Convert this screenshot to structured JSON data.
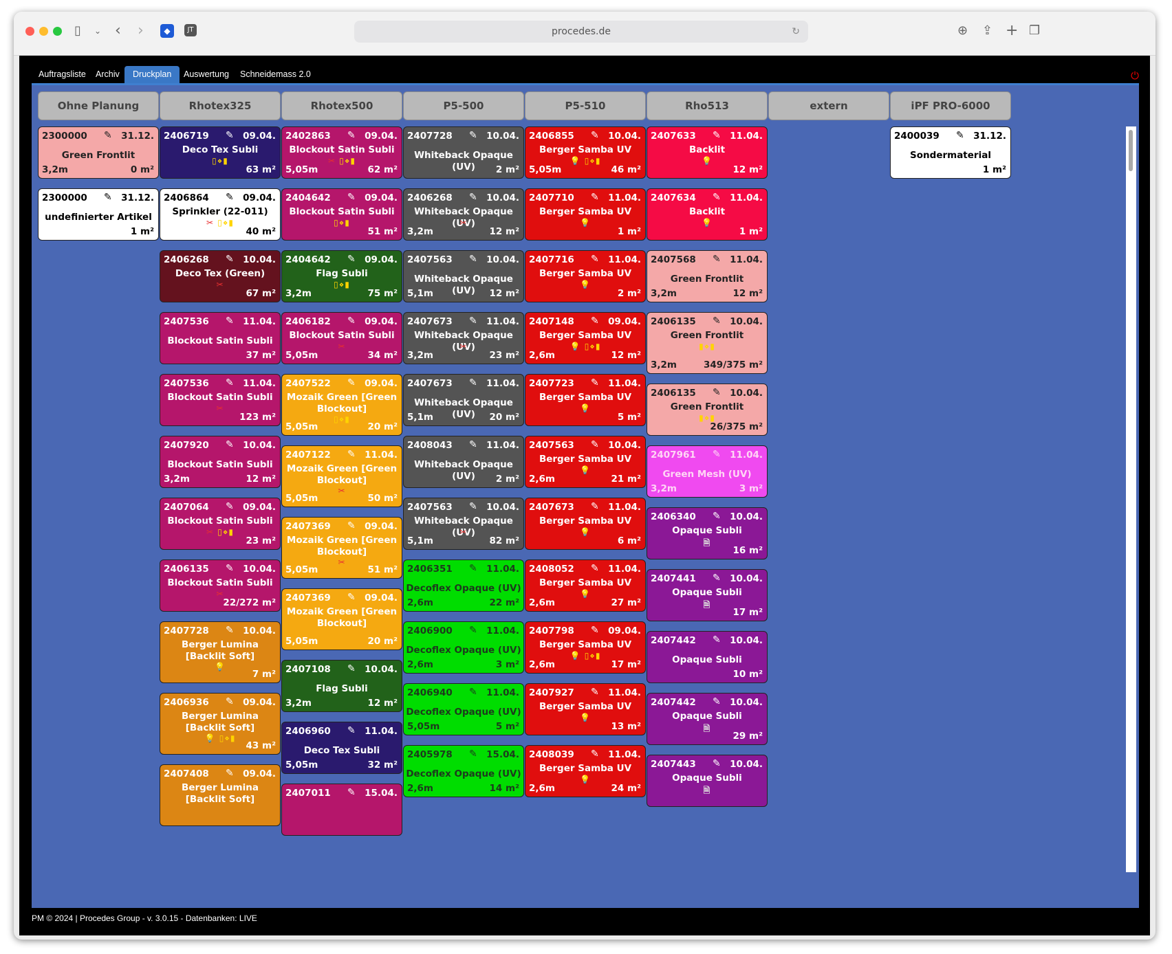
{
  "browser": {
    "url": "procedes.de"
  },
  "nav": {
    "tabs": [
      {
        "label": "Auftragsliste",
        "active": false
      },
      {
        "label": "Archiv",
        "active": false
      },
      {
        "label": "Druckplan",
        "active": true
      },
      {
        "label": "Auswertung",
        "active": false
      },
      {
        "label": "Schneidemass 2.0",
        "active": false
      }
    ]
  },
  "columns": [
    {
      "title": "Ohne Planung",
      "cards": [
        {
          "id": "2300000",
          "date": "31.12.",
          "name": "Green Frontlit",
          "icons": "",
          "length": "3,2m",
          "area": "0 m²",
          "color": "pink"
        },
        {
          "id": "2300000",
          "date": "31.12.",
          "name": "undefinierter Artikel",
          "icons": "",
          "length": "",
          "area": "1 m²",
          "color": "white"
        }
      ]
    },
    {
      "title": "Rhotex325",
      "cards": [
        {
          "id": "2406719",
          "date": "09.04.",
          "name": "Deco Tex Subli",
          "icons": "▯⋄▮",
          "length": "",
          "area": "63 m²",
          "color": "navy"
        },
        {
          "id": "2406864",
          "date": "09.04.",
          "name": "Sprinkler (22-011)",
          "icons": "✂ ▯⋄▮",
          "length": "",
          "area": "40 m²",
          "color": "white"
        },
        {
          "id": "2406268",
          "date": "10.04.",
          "name": "Deco Tex (Green)",
          "icons": "✂",
          "length": "",
          "area": "67 m²",
          "color": "maroon"
        },
        {
          "id": "2407536",
          "date": "11.04.",
          "name": "Blockout Satin Subli",
          "icons": "",
          "length": "",
          "area": "37 m²",
          "color": "mag"
        },
        {
          "id": "2407536",
          "date": "11.04.",
          "name": "Blockout Satin Subli",
          "icons": "✂",
          "length": "",
          "area": "123 m²",
          "color": "mag"
        },
        {
          "id": "2407920",
          "date": "10.04.",
          "name": "Blockout Satin Subli",
          "icons": "",
          "length": "3,2m",
          "area": "12 m²",
          "color": "mag"
        },
        {
          "id": "2407064",
          "date": "09.04.",
          "name": "Blockout Satin Subli",
          "icons": "✂ ▯⋄▮",
          "length": "",
          "area": "23 m²",
          "color": "mag"
        },
        {
          "id": "2406135",
          "date": "10.04.",
          "name": "Blockout Satin Subli",
          "icons": "✂",
          "length": "",
          "area": "22/272 m²",
          "color": "mag"
        },
        {
          "id": "2407728",
          "date": "10.04.",
          "name": "Berger Lumina [Backlit Soft]",
          "icons": "💡",
          "length": "",
          "area": "7 m²",
          "color": "orange"
        },
        {
          "id": "2406936",
          "date": "09.04.",
          "name": "Berger Lumina [Backlit Soft]",
          "icons": "💡 ▯⋄▮",
          "length": "",
          "area": "43 m²",
          "color": "orange"
        },
        {
          "id": "2407408",
          "date": "09.04.",
          "name": "Berger Lumina [Backlit Soft]",
          "icons": "",
          "length": "",
          "area": "",
          "color": "orange"
        }
      ]
    },
    {
      "title": "Rhotex500",
      "cards": [
        {
          "id": "2402863",
          "date": "09.04.",
          "name": "Blockout Satin Subli",
          "icons": "✂ ▯⋄▮",
          "length": "5,05m",
          "area": "62 m²",
          "color": "mag"
        },
        {
          "id": "2404642",
          "date": "09.04.",
          "name": "Blockout Satin Subli",
          "icons": "▯⋄▮",
          "length": "",
          "area": "51 m²",
          "color": "mag"
        },
        {
          "id": "2404642",
          "date": "09.04.",
          "name": "Flag Subli",
          "icons": "▯⋄▮",
          "length": "3,2m",
          "area": "75 m²",
          "color": "dgreen"
        },
        {
          "id": "2406182",
          "date": "09.04.",
          "name": "Blockout Satin Subli",
          "icons": "✂",
          "length": "5,05m",
          "area": "34 m²",
          "color": "mag"
        },
        {
          "id": "2407522",
          "date": "09.04.",
          "name": "Mozaik Green [Green Blockout]",
          "icons": "▯⋄▮",
          "length": "5,05m",
          "area": "20 m²",
          "color": "amber"
        },
        {
          "id": "2407122",
          "date": "11.04.",
          "name": "Mozaik Green [Green Blockout]",
          "icons": "✂",
          "length": "5,05m",
          "area": "50 m²",
          "color": "amber"
        },
        {
          "id": "2407369",
          "date": "09.04.",
          "name": "Mozaik Green [Green Blockout]",
          "icons": "✂",
          "length": "5,05m",
          "area": "51 m²",
          "color": "amber"
        },
        {
          "id": "2407369",
          "date": "09.04.",
          "name": "Mozaik Green [Green Blockout]",
          "icons": "",
          "length": "5,05m",
          "area": "20 m²",
          "color": "amber"
        },
        {
          "id": "2407108",
          "date": "10.04.",
          "name": "Flag Subli",
          "icons": "",
          "length": "3,2m",
          "area": "12 m²",
          "color": "dgreen"
        },
        {
          "id": "2406960",
          "date": "11.04.",
          "name": "Deco Tex Subli",
          "icons": "",
          "length": "5,05m",
          "area": "32 m²",
          "color": "navy"
        },
        {
          "id": "2407011",
          "date": "15.04.",
          "name": "",
          "icons": "",
          "length": "",
          "area": "",
          "color": "mag"
        }
      ]
    },
    {
      "title": "P5-500",
      "cards": [
        {
          "id": "2407728",
          "date": "10.04.",
          "name": "Whiteback Opaque (UV)",
          "icons": "",
          "length": "",
          "area": "2 m²",
          "color": "gray"
        },
        {
          "id": "2406268",
          "date": "10.04.",
          "name": "Whiteback Opaque (UV)",
          "icons": "✂",
          "length": "3,2m",
          "area": "12 m²",
          "color": "gray"
        },
        {
          "id": "2407563",
          "date": "10.04.",
          "name": "Whiteback Opaque (UV)",
          "icons": "",
          "length": "5,1m",
          "area": "12 m²",
          "color": "gray"
        },
        {
          "id": "2407673",
          "date": "11.04.",
          "name": "Whiteback Opaque (UV)",
          "icons": "✂",
          "length": "3,2m",
          "area": "23 m²",
          "color": "gray"
        },
        {
          "id": "2407673",
          "date": "11.04.",
          "name": "Whiteback Opaque (UV)",
          "icons": "",
          "length": "5,1m",
          "area": "20 m²",
          "color": "gray"
        },
        {
          "id": "2408043",
          "date": "11.04.",
          "name": "Whiteback Opaque (UV)",
          "icons": "",
          "length": "",
          "area": "2 m²",
          "color": "gray"
        },
        {
          "id": "2407563",
          "date": "10.04.",
          "name": "Whiteback Opaque (UV)",
          "icons": "✂",
          "length": "5,1m",
          "area": "82 m²",
          "color": "gray"
        },
        {
          "id": "2406351",
          "date": "11.04.",
          "name": "Decoflex Opaque (UV)",
          "icons": "",
          "length": "2,6m",
          "area": "22 m²",
          "color": "lgreen"
        },
        {
          "id": "2406900",
          "date": "11.04.",
          "name": "Decoflex Opaque (UV)",
          "icons": "",
          "length": "2,6m",
          "area": "3 m²",
          "color": "lgreen"
        },
        {
          "id": "2406940",
          "date": "11.04.",
          "name": "Decoflex Opaque (UV)",
          "icons": "",
          "length": "5,05m",
          "area": "5 m²",
          "color": "lgreen"
        },
        {
          "id": "2405978",
          "date": "15.04.",
          "name": "Decoflex Opaque (UV)",
          "icons": "",
          "length": "2,6m",
          "area": "14 m²",
          "color": "lgreen"
        }
      ]
    },
    {
      "title": "P5-510",
      "cards": [
        {
          "id": "2406855",
          "date": "10.04.",
          "name": "Berger Samba UV",
          "icons": "💡 ▯⋄▮",
          "length": "5,05m",
          "area": "46 m²",
          "color": "red"
        },
        {
          "id": "2407710",
          "date": "11.04.",
          "name": "Berger Samba UV",
          "icons": "💡",
          "length": "",
          "area": "1 m²",
          "color": "red"
        },
        {
          "id": "2407716",
          "date": "11.04.",
          "name": "Berger Samba UV",
          "icons": "💡",
          "length": "",
          "area": "2 m²",
          "color": "red"
        },
        {
          "id": "2407148",
          "date": "09.04.",
          "name": "Berger Samba UV",
          "icons": "💡 ▯⋄▮",
          "length": "2,6m",
          "area": "12 m²",
          "color": "red"
        },
        {
          "id": "2407723",
          "date": "11.04.",
          "name": "Berger Samba UV",
          "icons": "💡",
          "length": "",
          "area": "5 m²",
          "color": "red"
        },
        {
          "id": "2407563",
          "date": "10.04.",
          "name": "Berger Samba UV",
          "icons": "💡",
          "length": "2,6m",
          "area": "21 m²",
          "color": "red"
        },
        {
          "id": "2407673",
          "date": "11.04.",
          "name": "Berger Samba UV",
          "icons": "💡",
          "length": "",
          "area": "6 m²",
          "color": "red"
        },
        {
          "id": "2408052",
          "date": "11.04.",
          "name": "Berger Samba UV",
          "icons": "💡",
          "length": "2,6m",
          "area": "27 m²",
          "color": "red"
        },
        {
          "id": "2407798",
          "date": "09.04.",
          "name": "Berger Samba UV",
          "icons": "💡 ▯⋄▮",
          "length": "2,6m",
          "area": "17 m²",
          "color": "red"
        },
        {
          "id": "2407927",
          "date": "11.04.",
          "name": "Berger Samba UV",
          "icons": "💡",
          "length": "",
          "area": "13 m²",
          "color": "red"
        },
        {
          "id": "2408039",
          "date": "11.04.",
          "name": "Berger Samba UV",
          "icons": "💡",
          "length": "2,6m",
          "area": "24 m²",
          "color": "red"
        }
      ]
    },
    {
      "title": "Rho513",
      "cards": [
        {
          "id": "2407633",
          "date": "11.04.",
          "name": "Backlit",
          "icons": "💡",
          "length": "",
          "area": "12 m²",
          "color": "rose"
        },
        {
          "id": "2407634",
          "date": "11.04.",
          "name": "Backlit",
          "icons": "💡",
          "length": "",
          "area": "1 m²",
          "color": "rose"
        },
        {
          "id": "2407568",
          "date": "11.04.",
          "name": "Green Frontlit",
          "icons": "",
          "length": "3,2m",
          "area": "12 m²",
          "color": "pink"
        },
        {
          "id": "2406135",
          "date": "10.04.",
          "name": "Green Frontlit",
          "icons": "▮⋄▮",
          "length": "3,2m",
          "area": "349/375 m²",
          "color": "pink"
        },
        {
          "id": "2406135",
          "date": "10.04.",
          "name": "Green Frontlit",
          "icons": "▮⋄▮",
          "length": "",
          "area": "26/375 m²",
          "color": "pink"
        },
        {
          "id": "2407961",
          "date": "11.04.",
          "name": "Green Mesh (UV)",
          "icons": "",
          "length": "3,2m",
          "area": "3 m²",
          "color": "fuch"
        },
        {
          "id": "2406340",
          "date": "10.04.",
          "name": "Opaque Subli",
          "icons": "🗎",
          "length": "",
          "area": "16 m²",
          "color": "purple"
        },
        {
          "id": "2407441",
          "date": "10.04.",
          "name": "Opaque Subli",
          "icons": "🗎",
          "length": "",
          "area": "17 m²",
          "color": "purple"
        },
        {
          "id": "2407442",
          "date": "10.04.",
          "name": "Opaque Subli",
          "icons": "",
          "length": "",
          "area": "10 m²",
          "color": "purple"
        },
        {
          "id": "2407442",
          "date": "10.04.",
          "name": "Opaque Subli",
          "icons": "🗎",
          "length": "",
          "area": "29 m²",
          "color": "purple"
        },
        {
          "id": "2407443",
          "date": "10.04.",
          "name": "Opaque Subli",
          "icons": "🗎",
          "length": "",
          "area": "",
          "color": "purple"
        }
      ]
    },
    {
      "title": "extern",
      "cards": []
    },
    {
      "title": "iPF PRO-6000",
      "cards": [
        {
          "id": "2400039",
          "date": "31.12.",
          "name": "Sondermaterial",
          "icons": "",
          "length": "",
          "area": "1 m²",
          "color": "white"
        }
      ]
    }
  ],
  "footer": {
    "text": "PM © 2024 | Procedes Group - v. 3.0.15 - Datenbanken: LIVE"
  }
}
